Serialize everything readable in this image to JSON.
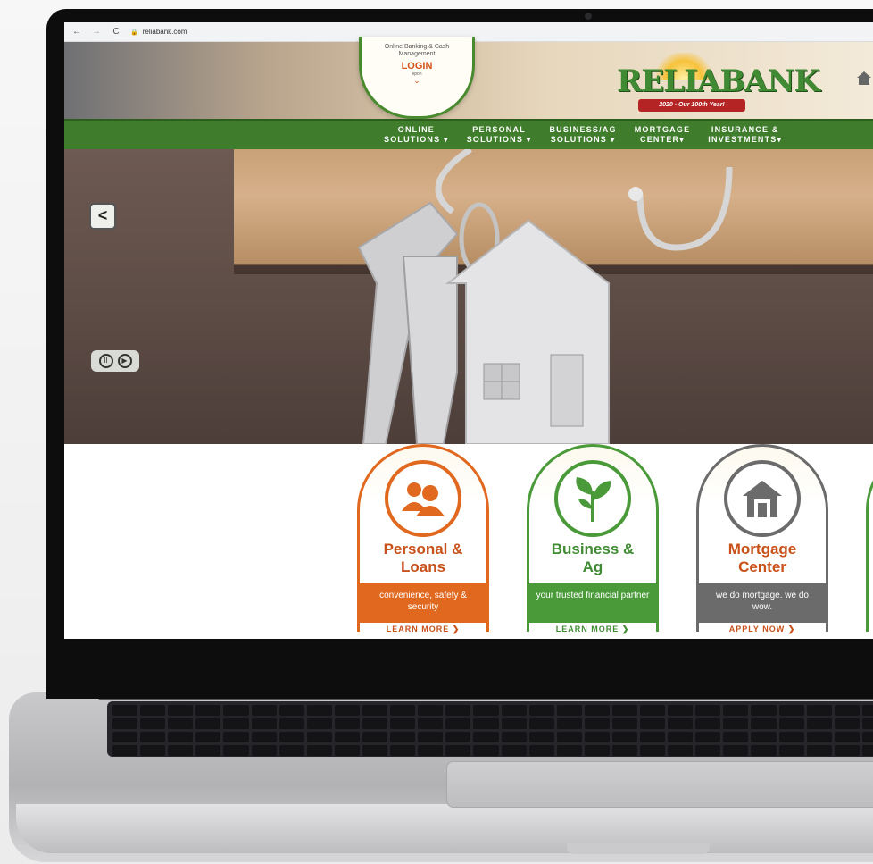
{
  "browser": {
    "back_icon": "back-arrow-icon",
    "forward_icon": "forward-arrow-icon",
    "reload_icon": "reload-icon",
    "url": "reliabank.com"
  },
  "login_badge": {
    "line1": "Online Banking & Cash",
    "line2": "Management",
    "login_label": "LOGIN",
    "sub": "epon"
  },
  "logo": {
    "name": "RELIABANK",
    "ribbon": "2020 · Our 100th Year!"
  },
  "nav": {
    "items": [
      {
        "label": "ONLINE\nSOLUTIONS ▾"
      },
      {
        "label": "PERSONAL\nSOLUTIONS ▾"
      },
      {
        "label": "BUSINESS/AG\nSOLUTIONS ▾"
      },
      {
        "label": "MORTGAGE\nCENTER▾"
      },
      {
        "label": "INSURANCE &\nINVESTMENTS▾"
      }
    ]
  },
  "hero": {
    "prev_label": "<",
    "pause_label": "II",
    "play_label": "▶"
  },
  "cards": [
    {
      "title": "Personal &\nLoans",
      "tagline": "convenience, safety & security",
      "cta": "LEARN MORE ❯",
      "icon": "people-icon",
      "color": "#e0691f"
    },
    {
      "title": "Business &\nAg",
      "tagline": "your trusted financial partner",
      "cta": "LEARN MORE ❯",
      "icon": "sprout-icon",
      "color": "#4a9a3a"
    },
    {
      "title": "Mortgage\nCenter",
      "tagline": "we do mortgage. we do wow.",
      "cta": "APPLY NOW ❯",
      "icon": "house-icon",
      "color": "#6b6b6b"
    }
  ],
  "colors": {
    "brand_green": "#3f7d2c",
    "orange": "#e0691f",
    "gray": "#6b6b6b",
    "logo_red": "#b52424"
  }
}
